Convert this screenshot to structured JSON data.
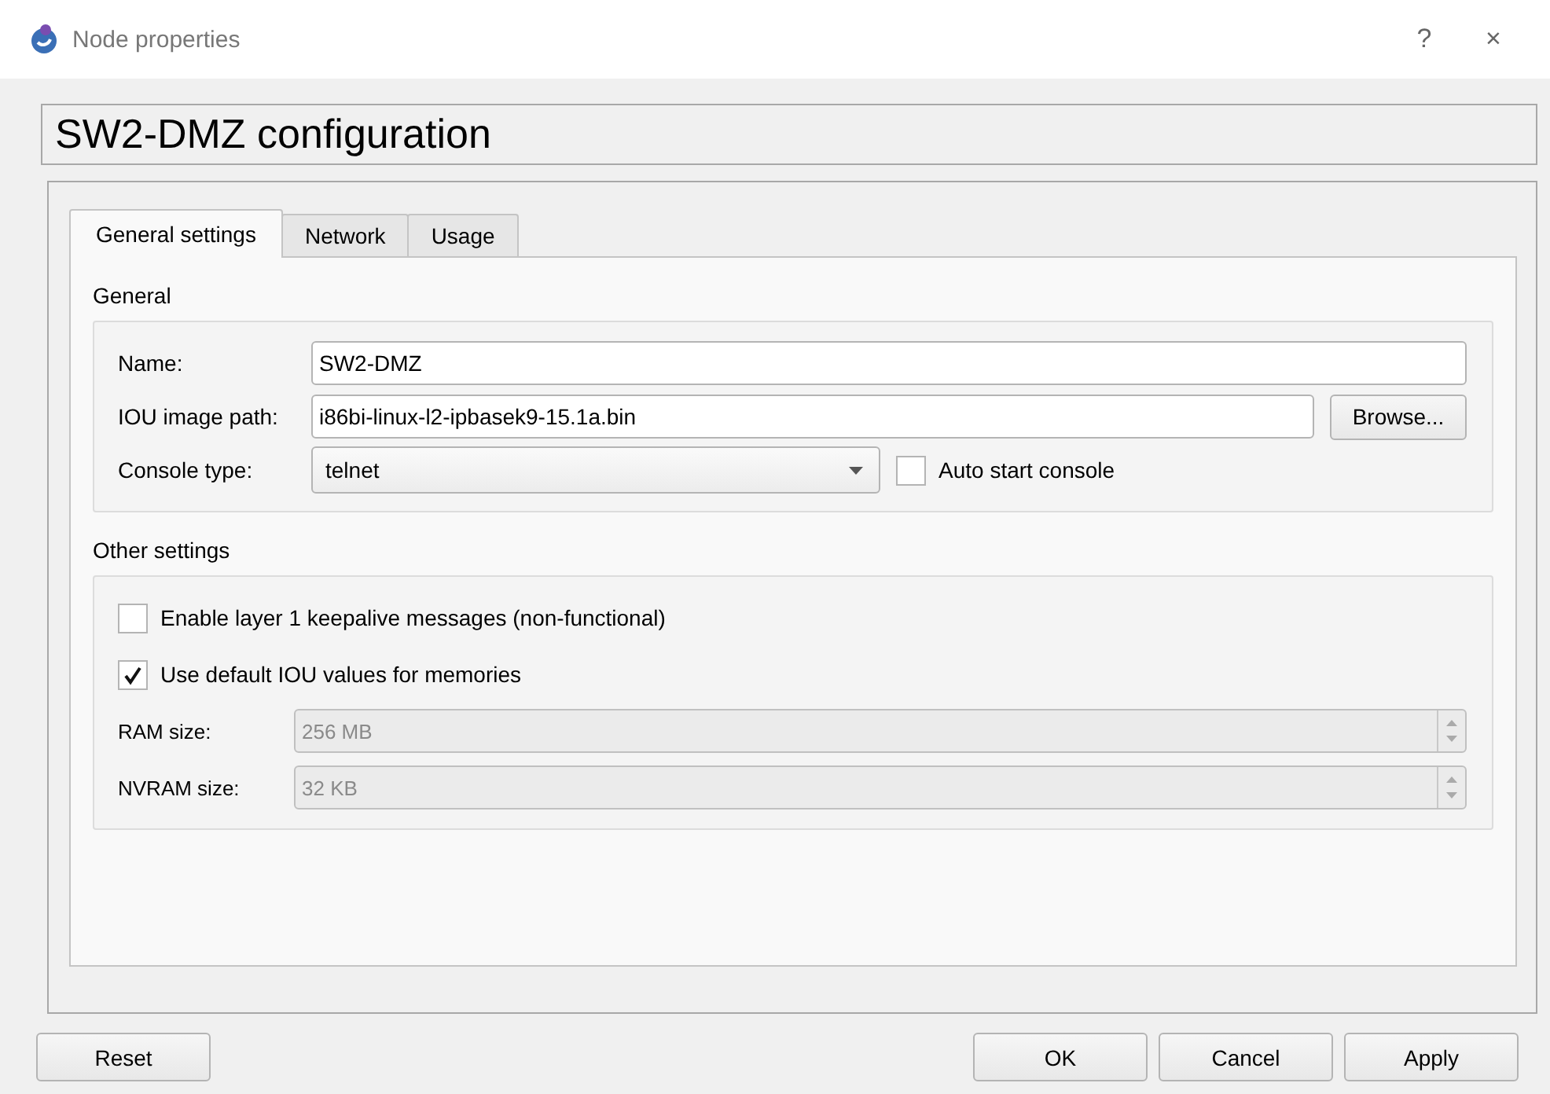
{
  "window": {
    "title": "Node properties",
    "help": "?",
    "close": "×"
  },
  "header": "SW2-DMZ configuration",
  "tabs": [
    {
      "label": "General settings",
      "selected": true
    },
    {
      "label": "Network",
      "selected": false
    },
    {
      "label": "Usage",
      "selected": false
    }
  ],
  "general": {
    "title": "General",
    "fields": [
      {
        "kind": "text",
        "label": "Name:",
        "value": "SW2-DMZ"
      },
      {
        "kind": "file",
        "label": "IOU image path:",
        "value": "i86bi-linux-l2-ipbasek9-15.1a.bin",
        "button": "Browse..."
      },
      {
        "kind": "dropdown",
        "label": "Console type:",
        "value": "telnet",
        "checkbox": {
          "label": "Auto start console",
          "checked": false
        }
      }
    ]
  },
  "other": {
    "title": "Other settings",
    "checkboxes": [
      {
        "label": "Enable layer 1 keepalive messages (non-functional)",
        "checked": false
      },
      {
        "label": "Use default IOU values for memories",
        "checked": true
      }
    ],
    "spinboxes": [
      {
        "label": "RAM size:",
        "value": "256 MB",
        "disabled": true
      },
      {
        "label": "NVRAM size:",
        "value": "32 KB",
        "disabled": true
      }
    ]
  },
  "buttons": {
    "left": [
      "Reset"
    ],
    "right": [
      "OK",
      "Cancel",
      "Apply"
    ]
  }
}
